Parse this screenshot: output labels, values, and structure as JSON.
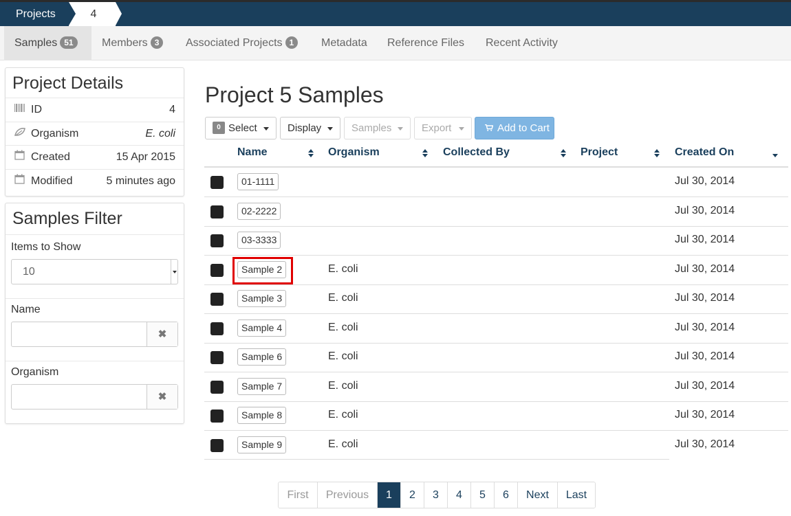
{
  "breadcrumb": {
    "projects": "Projects",
    "current": "4"
  },
  "tabs": [
    {
      "label": "Samples",
      "badge": "51"
    },
    {
      "label": "Members",
      "badge": "3"
    },
    {
      "label": "Associated Projects",
      "badge": "1"
    },
    {
      "label": "Metadata"
    },
    {
      "label": "Reference Files"
    },
    {
      "label": "Recent Activity"
    }
  ],
  "project_details": {
    "title": "Project Details",
    "rows": [
      {
        "icon": "barcode-icon",
        "label": "ID",
        "value": "4"
      },
      {
        "icon": "leaf-icon",
        "label": "Organism",
        "value": "E. coli"
      },
      {
        "icon": "calendar-icon",
        "label": "Created",
        "value": "15 Apr 2015"
      },
      {
        "icon": "calendar-icon",
        "label": "Modified",
        "value": "5 minutes ago"
      }
    ]
  },
  "samples_filter": {
    "title": "Samples Filter",
    "items_label": "Items to Show",
    "items_value": "10",
    "name_label": "Name",
    "organism_label": "Organism",
    "clear_glyph": "✖"
  },
  "main": {
    "title": "Project 5 Samples",
    "toolbar": {
      "select_count": "0",
      "select": "Select",
      "display": "Display",
      "samples": "Samples",
      "export": "Export",
      "add_to_cart": "Add to Cart"
    },
    "columns": [
      "Name",
      "Organism",
      "Collected By",
      "Project",
      "Created On"
    ],
    "rows": [
      {
        "name": "01-1111",
        "organism": "",
        "created": "Jul 30, 2014"
      },
      {
        "name": "02-2222",
        "organism": "",
        "created": "Jul 30, 2014"
      },
      {
        "name": "03-3333",
        "organism": "",
        "created": "Jul 30, 2014"
      },
      {
        "name": "Sample 2",
        "organism": "E. coli",
        "created": "Jul 30, 2014"
      },
      {
        "name": "Sample 3",
        "organism": "E. coli",
        "created": "Jul 30, 2014"
      },
      {
        "name": "Sample 4",
        "organism": "E. coli",
        "created": "Jul 30, 2014"
      },
      {
        "name": "Sample 6",
        "organism": "E. coli",
        "created": "Jul 30, 2014"
      },
      {
        "name": "Sample 7",
        "organism": "E. coli",
        "created": "Jul 30, 2014"
      },
      {
        "name": "Sample 8",
        "organism": "E. coli",
        "created": "Jul 30, 2014"
      },
      {
        "name": "Sample 9",
        "organism": "E. coli",
        "created": "Jul 30, 2014"
      }
    ]
  },
  "pagination": [
    "First",
    "Previous",
    "1",
    "2",
    "3",
    "4",
    "5",
    "6",
    "Next",
    "Last"
  ],
  "colors": {
    "brand": "#1a3f5c",
    "cart": "#7fb5e2",
    "highlight": "#e00000"
  }
}
